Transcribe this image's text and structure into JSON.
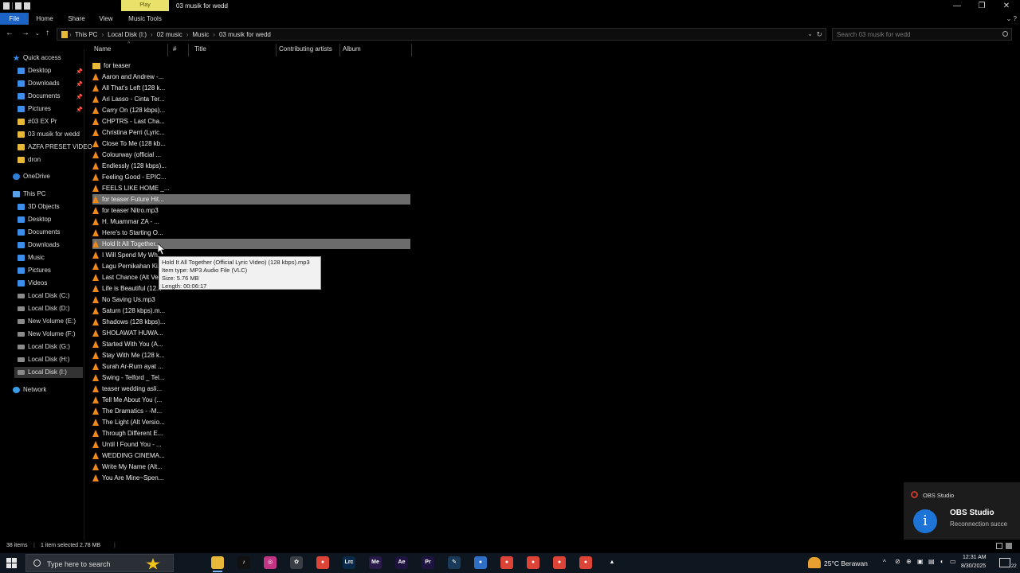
{
  "window": {
    "title": "03 musik for wedd",
    "context_tab": "Play",
    "controls": {
      "minimize": "—",
      "maximize": "❐",
      "close": "✕"
    }
  },
  "ribbon": {
    "tabs": [
      "File",
      "Home",
      "Share",
      "View",
      "Music Tools"
    ],
    "right": "⌄ ?"
  },
  "address": {
    "crumbs": [
      "This PC",
      "Local Disk (I:)",
      "02 music",
      "Music",
      "03 musik for wedd"
    ],
    "search_placeholder": "Search 03 musik for wedd"
  },
  "nav": {
    "quick_access": "Quick access",
    "quick_items": [
      {
        "label": "Desktop",
        "icon": "desktop-icon",
        "pinned": true
      },
      {
        "label": "Downloads",
        "icon": "downloads-icon",
        "pinned": true
      },
      {
        "label": "Documents",
        "icon": "documents-icon",
        "pinned": true
      },
      {
        "label": "Pictures",
        "icon": "pictures-icon",
        "pinned": true
      },
      {
        "label": "#03 EX Pr",
        "icon": "folder-icon",
        "pinned": false
      },
      {
        "label": "03 musik for wedd",
        "icon": "folder-icon",
        "pinned": false
      },
      {
        "label": "AZFA PRESET VIDEO",
        "icon": "folder-icon",
        "pinned": false
      },
      {
        "label": "dron",
        "icon": "folder-icon",
        "pinned": false
      }
    ],
    "onedrive": "OneDrive",
    "this_pc": "This PC",
    "pc_items": [
      {
        "label": "3D Objects",
        "icon": "3d-objects-icon"
      },
      {
        "label": "Desktop",
        "icon": "desktop-icon"
      },
      {
        "label": "Documents",
        "icon": "documents-icon"
      },
      {
        "label": "Downloads",
        "icon": "downloads-icon"
      },
      {
        "label": "Music",
        "icon": "music-icon"
      },
      {
        "label": "Pictures",
        "icon": "pictures-icon"
      },
      {
        "label": "Videos",
        "icon": "videos-icon"
      },
      {
        "label": "Local Disk (C:)",
        "icon": "drive-icon"
      },
      {
        "label": "Local Disk (D:)",
        "icon": "drive-icon"
      },
      {
        "label": "New Volume (E:)",
        "icon": "drive-icon"
      },
      {
        "label": "New Volume (F:)",
        "icon": "drive-icon"
      },
      {
        "label": "Local Disk (G:)",
        "icon": "drive-icon"
      },
      {
        "label": "Local Disk (H:)",
        "icon": "drive-icon"
      },
      {
        "label": "Local Disk (I:)",
        "icon": "drive-icon"
      }
    ],
    "network": "Network"
  },
  "columns": [
    "Name",
    "#",
    "Title",
    "Contributing artists",
    "Album"
  ],
  "files": [
    {
      "name": "for teaser",
      "type": "folder"
    },
    {
      "name": "Aaron and Andrew -...",
      "type": "vlc"
    },
    {
      "name": "All That's Left (128 k...",
      "type": "vlc"
    },
    {
      "name": "Ari Lasso - Cinta Ter...",
      "type": "vlc"
    },
    {
      "name": "Carry On (128 kbps)...",
      "type": "vlc"
    },
    {
      "name": "CHPTRS - Last Cha...",
      "type": "vlc"
    },
    {
      "name": "Christina Perri (Lyric...",
      "type": "vlc"
    },
    {
      "name": "Close To Me (128 kb...",
      "type": "vlc"
    },
    {
      "name": "Colourway (official ...",
      "type": "vlc"
    },
    {
      "name": "Endlessly (128 kbps)...",
      "type": "vlc"
    },
    {
      "name": "Feeling Good - EPIC...",
      "type": "vlc"
    },
    {
      "name": "FEELS LIKE HOME _...",
      "type": "vlc"
    },
    {
      "name": "for teaser Future Hit...",
      "type": "vlc",
      "highlight": true
    },
    {
      "name": "for teaser Nitro.mp3",
      "type": "vlc"
    },
    {
      "name": "H. Muammar ZA - ...",
      "type": "vlc"
    },
    {
      "name": "Here's to Starting O...",
      "type": "vlc"
    },
    {
      "name": "Hold It All Together...",
      "type": "vlc",
      "highlight": true
    },
    {
      "name": "I Will Spend My Wh...",
      "type": "vlc"
    },
    {
      "name": "Lagu Pernikahan Ki...",
      "type": "vlc"
    },
    {
      "name": "Last Chance (Alt Ve...",
      "type": "vlc"
    },
    {
      "name": "Life is Beautiful (12...",
      "type": "vlc"
    },
    {
      "name": "No Saving Us.mp3",
      "type": "vlc"
    },
    {
      "name": "Saturn (128 kbps).m...",
      "type": "vlc"
    },
    {
      "name": "Shadows (128 kbps)...",
      "type": "vlc"
    },
    {
      "name": "SHOLAWAT HUWA...",
      "type": "vlc"
    },
    {
      "name": "Started With You (A...",
      "type": "vlc"
    },
    {
      "name": "Stay With Me (128 k...",
      "type": "vlc"
    },
    {
      "name": "Surah Ar-Rum ayat ...",
      "type": "vlc"
    },
    {
      "name": "Swing - Telford _ Tel...",
      "type": "vlc"
    },
    {
      "name": "teaser wedding asli...",
      "type": "vlc"
    },
    {
      "name": "Tell Me About You (...",
      "type": "vlc"
    },
    {
      "name": "The Dramatics - -M...",
      "type": "vlc"
    },
    {
      "name": "The Light (Alt Versio...",
      "type": "vlc"
    },
    {
      "name": "Through Different E...",
      "type": "vlc"
    },
    {
      "name": "Until I Found You - ...",
      "type": "vlc"
    },
    {
      "name": "WEDDING CINEMA...",
      "type": "vlc"
    },
    {
      "name": "Write My Name (Alt...",
      "type": "vlc"
    },
    {
      "name": "You Are Mine~Spen...",
      "type": "vlc"
    }
  ],
  "tooltip": {
    "line1": "Hold It All Together (Official Lyric Video) (128 kbps).mp3",
    "line2": "Item type: MP3 Audio File (VLC)",
    "line3": "Size: 5.76 MB",
    "line4": "Length: 00:06:17"
  },
  "status": {
    "items": "38 items",
    "selected": "1 item selected  2.78 MB"
  },
  "notification": {
    "app": "OBS Studio",
    "title": "OBS Studio",
    "body": "Reconnection succe"
  },
  "taskbar": {
    "search_placeholder": "Type here to search",
    "apps": [
      {
        "icon": "task-view-icon",
        "label": "",
        "color": "#0e1620"
      },
      {
        "icon": "file-explorer-icon",
        "label": "",
        "color": "#e8b83a",
        "active": true
      },
      {
        "icon": "tiktok-icon",
        "label": "♪",
        "color": "#111111"
      },
      {
        "icon": "instagram-icon",
        "label": "◎",
        "color": "#c13584"
      },
      {
        "icon": "chatgpt-icon",
        "label": "✿",
        "color": "#3a3f46"
      },
      {
        "icon": "chrome-icon",
        "label": "●",
        "color": "#db4437"
      },
      {
        "icon": "lightroom-classic-icon",
        "label": "Lrc",
        "color": "#0b2a4a"
      },
      {
        "icon": "media-encoder-icon",
        "label": "Me",
        "color": "#2a1a4a"
      },
      {
        "icon": "after-effects-icon",
        "label": "Ae",
        "color": "#1f1440"
      },
      {
        "icon": "premiere-pro-icon",
        "label": "Pr",
        "color": "#1f1440"
      },
      {
        "icon": "pen-app-icon",
        "label": "✎",
        "color": "#1a3a5a"
      },
      {
        "icon": "blue-circle-app-icon",
        "label": "●",
        "color": "#2f6fc6"
      },
      {
        "icon": "chrome-profile-1-icon",
        "label": "●",
        "color": "#db4437"
      },
      {
        "icon": "chrome-profile-2-icon",
        "label": "●",
        "color": "#db4437"
      },
      {
        "icon": "chrome-profile-3-icon",
        "label": "●",
        "color": "#db4437"
      },
      {
        "icon": "chrome-profile-4-icon",
        "label": "●",
        "color": "#db4437"
      },
      {
        "icon": "vlc-icon",
        "label": "▲",
        "color": "#0e1620"
      }
    ],
    "weather": "25°C  Berawan",
    "time": "12:31 AM",
    "date": "8/30/2025",
    "notif_count": "22"
  },
  "colors": {
    "file_tab": "#1c63c6",
    "context_tab": "#e9e26a",
    "highlight_row": "#6c6c6c",
    "vlc_orange": "#f0891b",
    "folder_yellow": "#e8b83a"
  }
}
